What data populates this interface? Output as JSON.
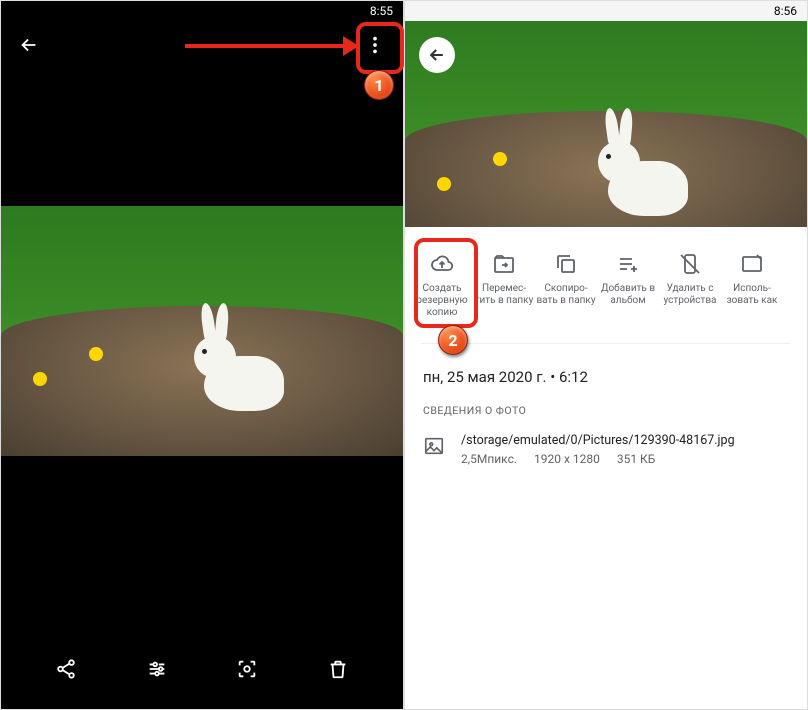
{
  "left_screen": {
    "time": "8:55"
  },
  "right_screen": {
    "time": "8:56",
    "actions": [
      {
        "name": "backup",
        "label": "Создать резервную копию"
      },
      {
        "name": "move",
        "label": "Перемес­тить в папку"
      },
      {
        "name": "copy",
        "label": "Скопиро­вать в папку"
      },
      {
        "name": "add-album",
        "label": "Добавить в альбом"
      },
      {
        "name": "delete-device",
        "label": "Удалить с устройства"
      },
      {
        "name": "use-as",
        "label": "Ис­поль­зовать как"
      }
    ],
    "datetime": "пн, 25 мая 2020 г. • 6:12",
    "details_title": "СВЕДЕНИЯ О ФОТО",
    "file": {
      "path": "/storage/emulated/0/Pictures/129390-48167.jpg",
      "megapixels": "2,5Мпикс.",
      "dimensions": "1920 x 1280",
      "size": "351 КБ"
    }
  },
  "callouts": {
    "one": "1",
    "two": "2"
  }
}
